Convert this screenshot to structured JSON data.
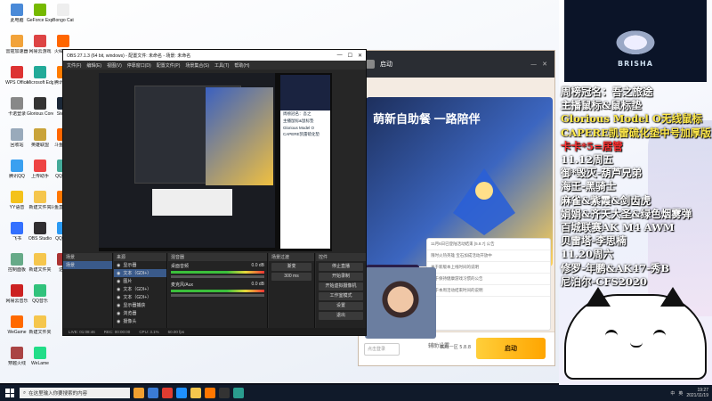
{
  "desktop": {
    "icons": [
      {
        "label": "此电脑",
        "color": "#4a8ad8"
      },
      {
        "label": "雷霆加速器",
        "color": "#f2a33a"
      },
      {
        "label": "WPS Office",
        "color": "#d33"
      },
      {
        "label": "卡诺登录",
        "color": "#888"
      },
      {
        "label": "回收站",
        "color": "#9ab"
      },
      {
        "label": "腾讯QQ",
        "color": "#3aa0f0"
      },
      {
        "label": "YY语音",
        "color": "#f4c21b"
      },
      {
        "label": "飞书",
        "color": "#3370ff"
      },
      {
        "label": "控制面板",
        "color": "#6a8"
      },
      {
        "label": "网易云音乐",
        "color": "#c22"
      },
      {
        "label": "WeGame",
        "color": "#ff6a00"
      },
      {
        "label": "穿越火线",
        "color": "#a44"
      },
      {
        "label": "GeForce Experience",
        "color": "#76b900"
      },
      {
        "label": "网易云游戏",
        "color": "#d44"
      },
      {
        "label": "Microsoft Edge",
        "color": "#2a9"
      },
      {
        "label": "Glorious Core",
        "color": "#333"
      },
      {
        "label": "英雄联盟",
        "color": "#c9a33a"
      },
      {
        "label": "上传助手",
        "color": "#e44"
      },
      {
        "label": "新建文件夹",
        "color": "#f5c64d"
      },
      {
        "label": "OBS Studio",
        "color": "#302e31"
      },
      {
        "label": "新建文件夹",
        "color": "#f5c64d"
      },
      {
        "label": "QQ音乐",
        "color": "#31c27c"
      },
      {
        "label": "新建文件夹",
        "color": "#f5c64d"
      },
      {
        "label": "WeLame",
        "color": "#2d8"
      },
      {
        "label": "Bongo Cat",
        "color": "#eee"
      },
      {
        "label": "火绒安全",
        "color": "#f60"
      },
      {
        "label": "腾讯视频",
        "color": "#ff7b00"
      },
      {
        "label": "Steam",
        "color": "#1b2838"
      },
      {
        "label": "斗鱼直播",
        "color": "#f60"
      },
      {
        "label": "QQ飞车",
        "color": "#4a9"
      },
      {
        "label": "斗鱼直播伴侣",
        "color": "#ff7700"
      },
      {
        "label": "QQ游戏",
        "color": "#2b9af3"
      },
      {
        "label": "逆战",
        "color": "#a33"
      }
    ]
  },
  "launcher": {
    "tab_title": "启动",
    "banner_text": "萌新自助餐 一路陪伴",
    "news": [
      "11月6日已登陆活动结束 [5.8.7] 公告",
      "限时火热英雄 宝石加成活动开放中",
      "关于新版本上线时间的说明",
      "关于保持健康游戏习惯的公告",
      "关于本周活动结束时间的说明"
    ],
    "login_label": "点击登录",
    "assist_label": "辅助设置",
    "version": "四叶一区 5.8.8",
    "start_label": "启动"
  },
  "obs": {
    "title": "OBS 27.1.3 (64 bit, windows) - 配置文件: 未命名 - 场景: 未命名",
    "menu": [
      "文件(F)",
      "编辑(E)",
      "视图(V)",
      "停靠窗口(D)",
      "配置文件(P)",
      "场景集合(S)",
      "工具(T)",
      "帮助(H)"
    ],
    "right_overlay_lines": [
      "周榜冠名：吾之",
      "主播鼠标&鼠标垫",
      "Glorious Model O",
      "CAPERE凯雷硫化垫"
    ],
    "scenes_header": "场景",
    "scenes": [
      "场景"
    ],
    "sources_header": "来源",
    "sources": [
      "显示器",
      "文本（GDI+）",
      "图片",
      "文本（GDI+）",
      "文本（GDI+）",
      "显示器捕获",
      "浏览器",
      "摄像头"
    ],
    "mixer_header": "混音器",
    "mixer": [
      {
        "name": "桌面音频",
        "db": "0.0 dB"
      },
      {
        "name": "麦克风/Aux",
        "db": "0.0 dB"
      }
    ],
    "transitions_header": "场景过渡",
    "transition_type": "渐变",
    "transition_duration": "300 ms",
    "controls_header": "控件",
    "controls": [
      "停止直播",
      "开始录制",
      "开始虚拟摄像机",
      "工作室模式",
      "设置",
      "退出"
    ],
    "status": [
      "LIVE: 01:08:46",
      "REC: 00:00:00",
      "CPU: 3.1%",
      "60.00 fps"
    ]
  },
  "overlay": {
    "brand": "BRISHA",
    "lines": [
      {
        "text": "周榜冠名：吾之旅途",
        "c": "w"
      },
      {
        "text": "主播鼠标&鼠标垫",
        "c": "w"
      },
      {
        "text": "Glorious Model O无线鼠标",
        "c": "y"
      },
      {
        "text": "CAPERE凯雷硫化垫中号加厚版",
        "c": "y"
      },
      {
        "text": "卡卡*5=居管",
        "c": "r"
      },
      {
        "text": "11.12周五",
        "c": "w"
      },
      {
        "text": "御*毁灭-葫芦兄弟",
        "c": "w"
      },
      {
        "text": "海王-黑骑士",
        "c": "w"
      },
      {
        "text": "麻雀&紫霞&剑齿虎",
        "c": "w"
      },
      {
        "text": "娟娟&齐天大圣&绿色烟雾弹",
        "c": "w"
      },
      {
        "text": "百城联赛AK M4 AWM",
        "c": "w"
      },
      {
        "text": "贝雷塔-李思楠",
        "c": "w"
      },
      {
        "text": "11.20周六",
        "c": "w"
      },
      {
        "text": "修罗-年鹏&AK47-秀B",
        "c": "w"
      },
      {
        "text": "尼泊尔-CFS2020",
        "c": "w"
      }
    ]
  },
  "taskbar": {
    "search_placeholder": "在这里输入你要搜索的内容",
    "apps": [
      "#f0a030",
      "#3a7bd5",
      "#e03c31",
      "#1e90ff",
      "#f5c64d",
      "#ff7700",
      "#333333",
      "#2a9d8f"
    ],
    "tray": [
      "中",
      "英"
    ],
    "time": "19:27",
    "date": "2021/11/19"
  }
}
